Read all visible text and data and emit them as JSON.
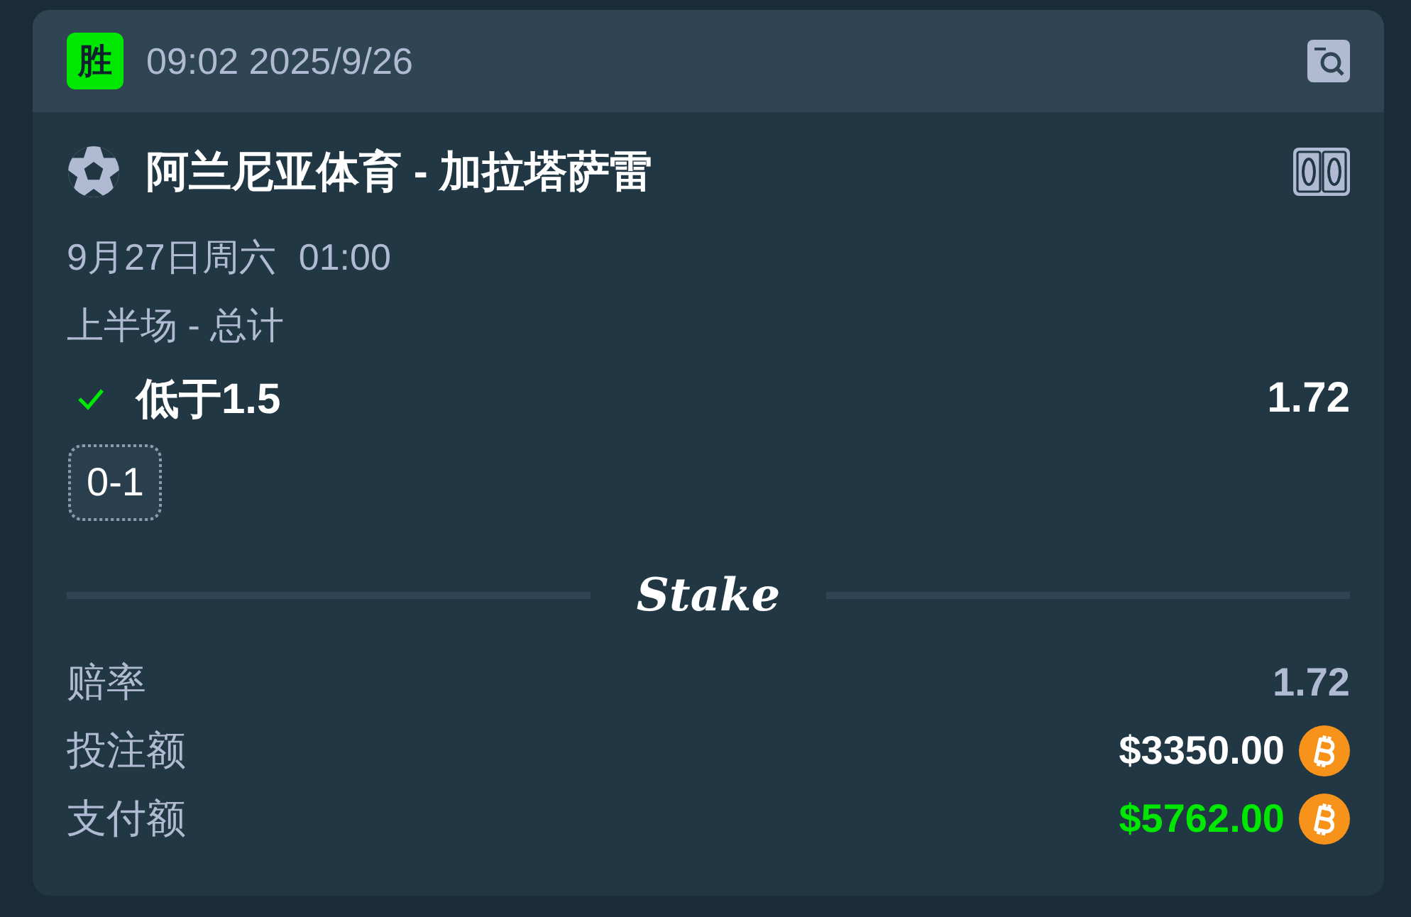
{
  "header": {
    "result_badge": "胜",
    "timestamp": "09:02 2025/9/26"
  },
  "event": {
    "title": "阿兰尼亚体育 - 加拉塔萨雷",
    "date": "9月27日周六",
    "time": "01:00",
    "market": "上半场 - 总计"
  },
  "selection": {
    "label": "低于1.5",
    "odds": "1.72",
    "won": true
  },
  "score": "0-1",
  "brand": {
    "logo": "Stake"
  },
  "summary": [
    {
      "kind": "odds",
      "label": "赔率",
      "value": "1.72"
    },
    {
      "kind": "stake",
      "label": "投注额",
      "value": "$3350.00"
    },
    {
      "kind": "payout",
      "label": "支付额",
      "value": "$5762.00"
    }
  ]
}
